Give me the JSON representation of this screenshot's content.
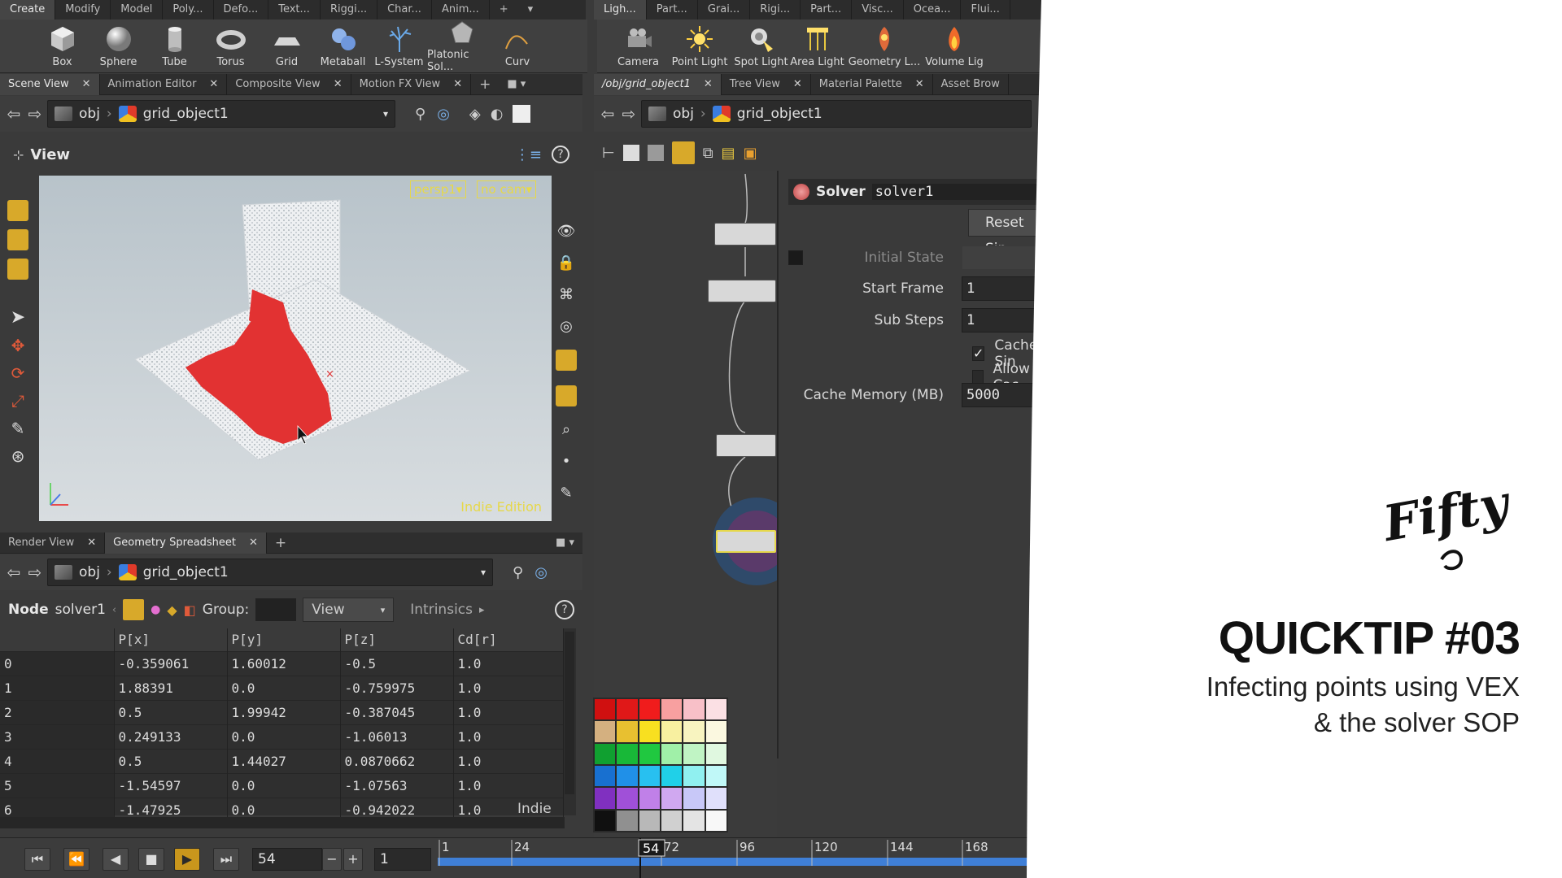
{
  "shelf": {
    "left_tabs": [
      "Create",
      "Modify",
      "Model",
      "Poly...",
      "Defo...",
      "Text...",
      "Riggi...",
      "Char...",
      "Anim..."
    ],
    "right_tabs": [
      "Ligh...",
      "Part...",
      "Grai...",
      "Rigi...",
      "Part...",
      "Visc...",
      "Ocea...",
      "Flui..."
    ],
    "left_tools": [
      "Box",
      "Sphere",
      "Tube",
      "Torus",
      "Grid",
      "Metaball",
      "L-System",
      "Platonic Sol...",
      "Curv"
    ],
    "right_tools": [
      "Camera",
      "Point Light",
      "Spot Light",
      "Area Light",
      "Geometry L...",
      "Volume Lig"
    ]
  },
  "left_pane": {
    "tabs": [
      "Scene View",
      "Animation Editor",
      "Composite View",
      "Motion FX View"
    ],
    "path_root": "obj",
    "path_node": "grid_object1",
    "view_label": "View",
    "camera": "persp1",
    "camera_mode": "no cam",
    "edition": "Indie Edition"
  },
  "right_pane": {
    "tabs": [
      "/obj/grid_object1",
      "Tree View",
      "Material Palette",
      "Asset Brow"
    ],
    "path_root": "obj",
    "path_node": "grid_object1"
  },
  "params": {
    "node_type": "Solver",
    "node_name": "solver1",
    "reset_label": "Reset Sin",
    "initial_state_label": "Initial State",
    "start_frame_label": "Start Frame",
    "start_frame": "1",
    "sub_steps_label": "Sub Steps",
    "sub_steps": "1",
    "cache_label": "Cache Sin",
    "allow_label": "Allow Cac",
    "cache_memory_label": "Cache Memory (MB)",
    "cache_memory": "5000"
  },
  "spreadsheet": {
    "tabs": [
      "Render View",
      "Geometry Spreadsheet"
    ],
    "path_root": "obj",
    "path_node": "grid_object1",
    "node_label": "Node",
    "node_name": "solver1",
    "group_label": "Group:",
    "view_select": "View",
    "intrinsics": "Intrinsics",
    "watermark": "Indie",
    "columns": [
      "",
      "P[x]",
      "P[y]",
      "P[z]",
      "Cd[r]"
    ],
    "rows": [
      [
        "0",
        "-0.359061",
        "1.60012",
        "-0.5",
        "1.0"
      ],
      [
        "1",
        "1.88391",
        "0.0",
        "-0.759975",
        "1.0"
      ],
      [
        "2",
        "0.5",
        "1.99942",
        "-0.387045",
        "1.0"
      ],
      [
        "3",
        "0.249133",
        "0.0",
        "-1.06013",
        "1.0"
      ],
      [
        "4",
        "0.5",
        "1.44027",
        "0.0870662",
        "1.0"
      ],
      [
        "5",
        "-1.54597",
        "0.0",
        "-1.07563",
        "1.0"
      ],
      [
        "6",
        "-1.47925",
        "0.0",
        "-0.942022",
        "1.0"
      ]
    ]
  },
  "timeline": {
    "current_frame": "54",
    "step": "1",
    "ticks": [
      "1",
      "24",
      "72",
      "96",
      "120",
      "144",
      "168"
    ],
    "marker": "54",
    "playhead_fraction": 0.317
  },
  "branding": {
    "title": "QUICKTIP #03",
    "subtitle_1": "Infecting points using VEX",
    "subtitle_2": "& the solver SOP"
  },
  "colors": {
    "accent": "#e6d84a",
    "play": "#c9961c",
    "infected": "#e23232",
    "timeline": "#3f7fd6"
  }
}
